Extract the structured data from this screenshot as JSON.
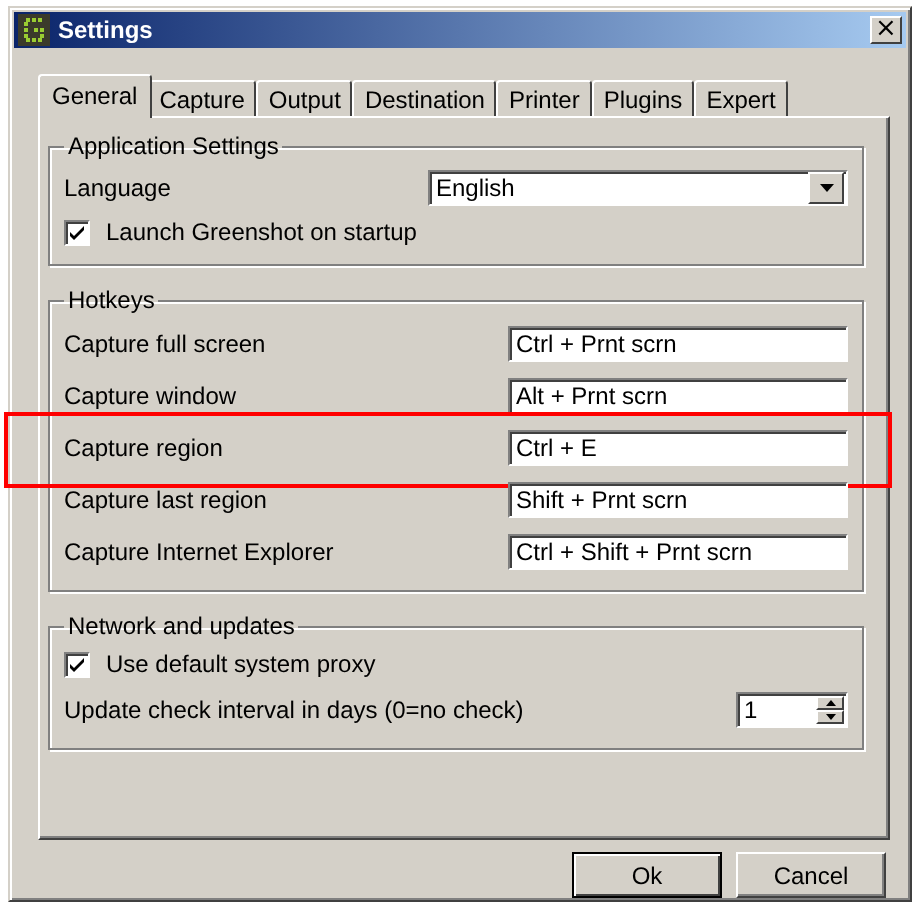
{
  "window": {
    "title": "Settings",
    "close": "×"
  },
  "tabs": [
    {
      "label": "General",
      "selected": true
    },
    {
      "label": "Capture",
      "selected": false
    },
    {
      "label": "Output",
      "selected": false
    },
    {
      "label": "Destination",
      "selected": false
    },
    {
      "label": "Printer",
      "selected": false
    },
    {
      "label": "Plugins",
      "selected": false
    },
    {
      "label": "Expert",
      "selected": false
    }
  ],
  "application_settings": {
    "title": "Application Settings",
    "language_label": "Language",
    "language_value": "English",
    "launch_on_startup": {
      "label": "Launch Greenshot on startup",
      "checked": true
    }
  },
  "hotkeys": {
    "title": "Hotkeys",
    "items": [
      {
        "label": "Capture full screen",
        "value": "Ctrl + Prnt scrn",
        "highlighted": false
      },
      {
        "label": "Capture window",
        "value": "Alt + Prnt scrn",
        "highlighted": false
      },
      {
        "label": "Capture region",
        "value": "Ctrl + E",
        "highlighted": true
      },
      {
        "label": "Capture last region",
        "value": "Shift + Prnt scrn",
        "highlighted": false
      },
      {
        "label": "Capture Internet Explorer",
        "value": "Ctrl + Shift + Prnt scrn",
        "highlighted": false
      }
    ]
  },
  "network": {
    "title": "Network and updates",
    "proxy": {
      "label": "Use default system proxy",
      "checked": true
    },
    "interval_label": "Update check interval in days (0=no check)",
    "interval_value": "1"
  },
  "buttons": [
    {
      "label": "Ok",
      "default": true
    },
    {
      "label": "Cancel",
      "default": false
    }
  ]
}
